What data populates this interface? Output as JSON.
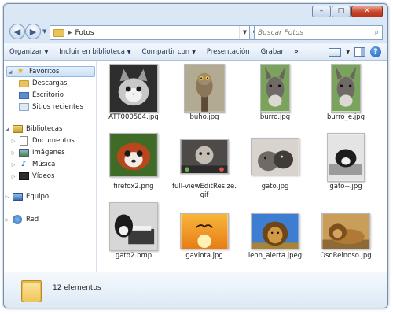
{
  "window": {
    "buttons": {
      "minimize": "–",
      "maximize": "□",
      "close": "✕"
    }
  },
  "address": {
    "separator": "▸",
    "path": "Fotos",
    "search_placeholder": "Buscar Fotos"
  },
  "toolbar": {
    "items": [
      "Organizar",
      "Incluir en biblioteca",
      "Compartir con",
      "Presentación",
      "Grabar"
    ],
    "more": "»"
  },
  "nav": {
    "favorites_label": "Favoritos",
    "favorites": [
      "Descargas",
      "Escritorio",
      "Sitios recientes"
    ],
    "libraries_label": "Bibliotecas",
    "libraries": [
      "Documentos",
      "Imágenes",
      "Música",
      "Vídeos"
    ],
    "computer_label": "Equipo",
    "network_label": "Red"
  },
  "files": [
    {
      "name": "ATT000504.jpg",
      "icon": "kitten-photo",
      "bg": "#3b3b3b"
    },
    {
      "name": "buho.jpg",
      "icon": "owl-photo",
      "bg": "#a8a089"
    },
    {
      "name": "burro.jpg",
      "icon": "donkey-photo",
      "bg": "#7aa35b"
    },
    {
      "name": "burro_e.jpg",
      "icon": "donkey-photo",
      "bg": "#7aa35b"
    },
    {
      "name": "firefox2.png",
      "icon": "red-panda-photo",
      "bg": "#4e7d2f"
    },
    {
      "name": "full-viewEditResize.gif",
      "icon": "cat-gif",
      "bg": "#5f5a55"
    },
    {
      "name": "gato.jpg",
      "icon": "cats-photo",
      "bg": "#c9c5be"
    },
    {
      "name": "gato--.jpg",
      "icon": "cat-keyboard-photo",
      "bg": "#d8d8d8"
    },
    {
      "name": "gato2.bmp",
      "icon": "cat-printer-photo",
      "bg": "#cfcfcf"
    },
    {
      "name": "gaviota.jpg",
      "icon": "seagull-sunset-photo",
      "bg": "#f0a431"
    },
    {
      "name": "leon_alerta.jpeg",
      "icon": "lion-photo",
      "bg": "#3c7bd0"
    },
    {
      "name": "OsoReinoso.jpg",
      "icon": "lion-lying-photo",
      "bg": "#b98f4c"
    }
  ],
  "status": {
    "count": "12 elementos"
  }
}
